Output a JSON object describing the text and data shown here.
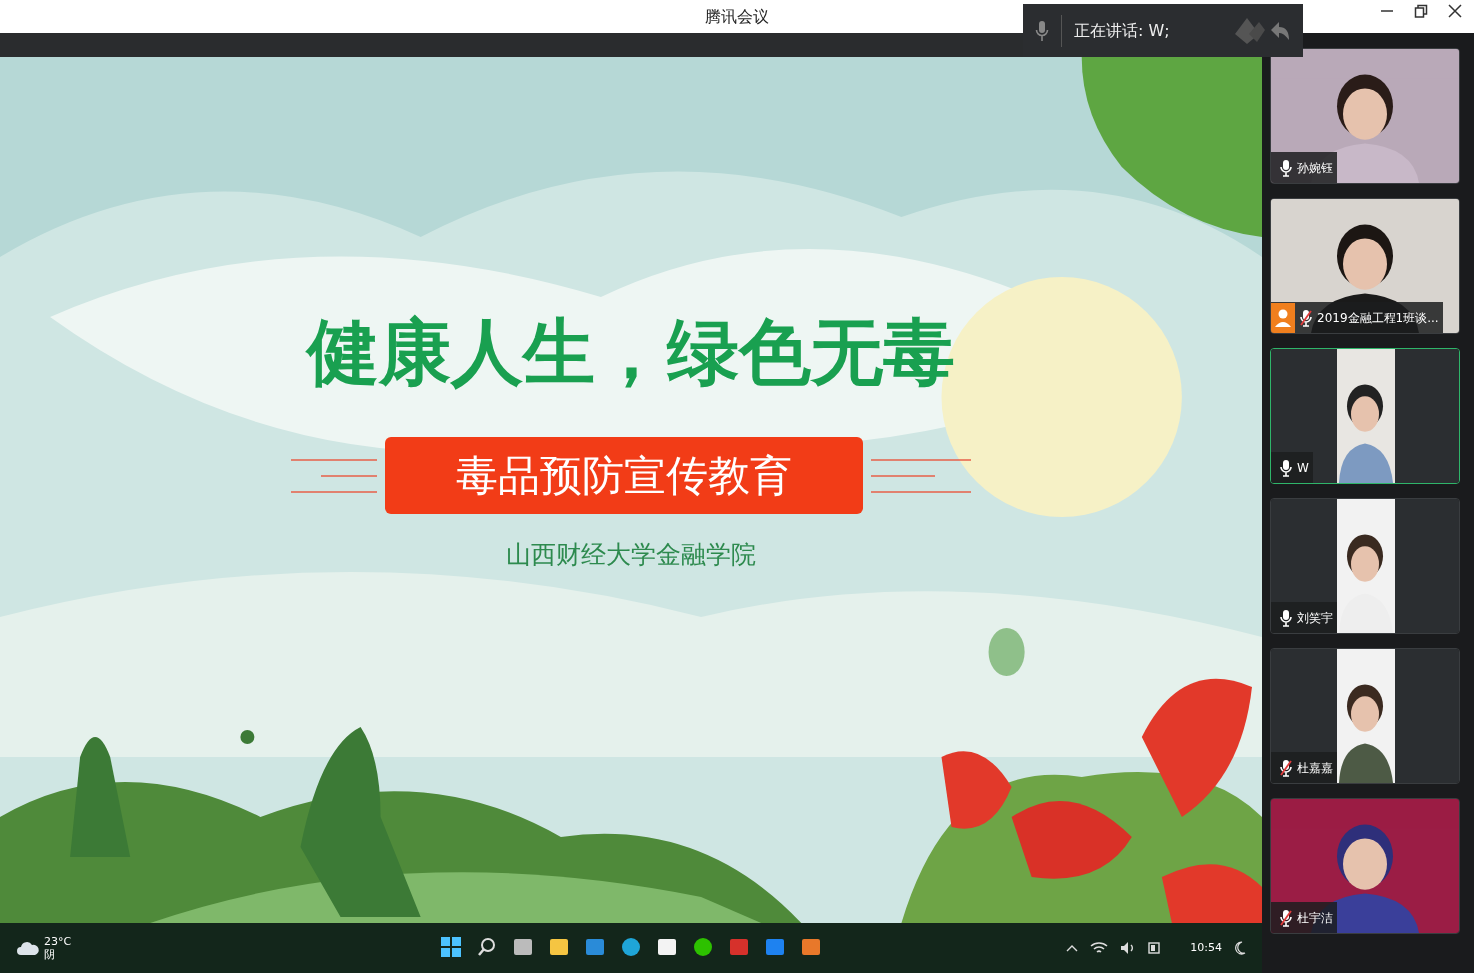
{
  "window": {
    "title": "腾讯会议"
  },
  "speaking": {
    "label": "正在讲话: W;"
  },
  "slide": {
    "title": "健康人生，绿色无毒",
    "banner": "毒品预防宣传教育",
    "subtitle": "山西财经大学金融学院"
  },
  "participants": [
    {
      "name": "孙婉钰",
      "muted": false,
      "selected": false,
      "avatar_badge": false,
      "kind": "full"
    },
    {
      "name": "2019金融工程1班谈...",
      "muted": true,
      "selected": false,
      "avatar_badge": true,
      "kind": "full"
    },
    {
      "name": "W",
      "muted": false,
      "selected": true,
      "avatar_badge": false,
      "kind": "portrait"
    },
    {
      "name": "刘笑宇",
      "muted": false,
      "selected": false,
      "avatar_badge": false,
      "kind": "portrait"
    },
    {
      "name": "杜嘉嘉",
      "muted": true,
      "selected": false,
      "avatar_badge": false,
      "kind": "portrait"
    },
    {
      "name": "杜宇洁",
      "muted": true,
      "selected": false,
      "avatar_badge": false,
      "kind": "full"
    }
  ],
  "taskbar": {
    "temperature": "23°C",
    "weather": "阴",
    "time": "10:54"
  }
}
